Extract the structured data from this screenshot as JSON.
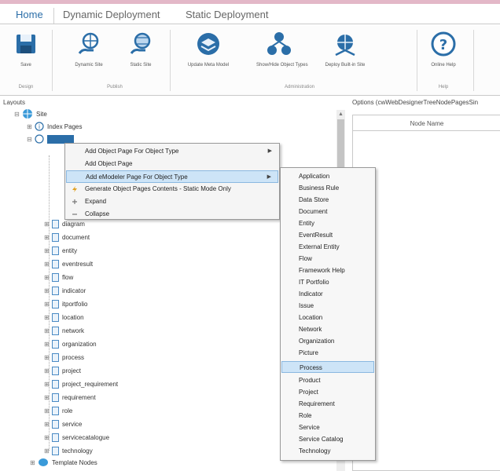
{
  "tabs": [
    "Home",
    "Dynamic Deployment",
    "Static Deployment"
  ],
  "ribbon": {
    "buttons": [
      "Save",
      "Dynamic Site",
      "Static Site",
      "Update Meta Model",
      "Show/Hide Object Types",
      "Deploy Built-in Site",
      "Online Help"
    ],
    "groups": [
      "Design",
      "Publish",
      "Administration",
      "Help"
    ]
  },
  "panels": {
    "layouts_title": "Layouts",
    "options_title": "Options (cwWebDesignerTreeNodePagesSin",
    "node_name_header": "Node Name"
  },
  "tree": {
    "root": "Site",
    "index_pages": "Index Pages",
    "items": [
      "diagram",
      "document",
      "entity",
      "eventresult",
      "flow",
      "indicator",
      "itportfolio",
      "location",
      "network",
      "organization",
      "process",
      "project",
      "project_requirement",
      "requirement",
      "role",
      "service",
      "servicecatalogue",
      "technology"
    ],
    "template_nodes": "Template Nodes"
  },
  "context_menu": {
    "items": [
      "Add Object Page For Object Type",
      "Add Object Page",
      "Add eModeler Page For Object Type",
      "Generate Object Pages Contents - Static Mode Only",
      "Expand",
      "Collapse"
    ],
    "highlighted": 2
  },
  "submenu": {
    "items": [
      "Application",
      "Business Rule",
      "Data Store",
      "Document",
      "Entity",
      "EventResult",
      "External Entity",
      "Flow",
      "Framework Help",
      "IT Portfolio",
      "Indicator",
      "Issue",
      "Location",
      "Network",
      "Organization",
      "Picture",
      "Process",
      "Product",
      "Project",
      "Requirement",
      "Role",
      "Service",
      "Service Catalog",
      "Technology"
    ],
    "highlighted": 16
  },
  "colors": {
    "accent": "#2b6ea8",
    "highlight": "#cde4f7",
    "top_bar": "#e3b8c8"
  }
}
